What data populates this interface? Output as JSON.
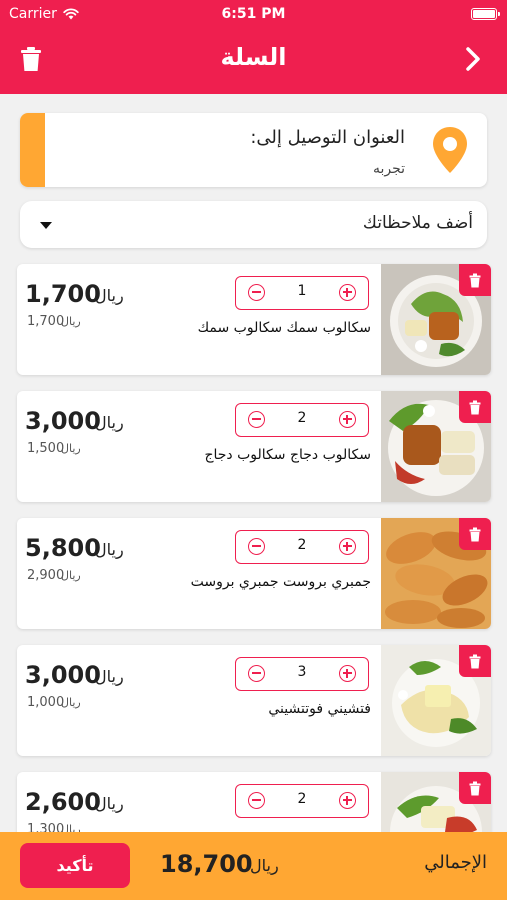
{
  "status_bar": {
    "carrier": "Carrier",
    "time": "6:51 PM"
  },
  "header": {
    "title": "السلة",
    "trash_icon": "trash-icon",
    "back_icon": "chevron-right-icon"
  },
  "address": {
    "label": "العنوان التوصيل إلى:",
    "value": "تجربه",
    "icon": "location-pin-icon"
  },
  "notes": {
    "placeholder": "أضف ملاحظاتك"
  },
  "currency": "ريال",
  "items": [
    {
      "name": "سكالوب سمك سكالوب سمك",
      "quantity": "1",
      "total": "1,700",
      "unit_price": "1,700"
    },
    {
      "name": "سكالوب دجاج سكالوب دجاج",
      "quantity": "2",
      "total": "3,000",
      "unit_price": "1,500"
    },
    {
      "name": "جمبري بروست جمبري بروست",
      "quantity": "2",
      "total": "5,800",
      "unit_price": "2,900"
    },
    {
      "name": "فتشيني فوتتشيني",
      "quantity": "3",
      "total": "3,000",
      "unit_price": "1,000"
    },
    {
      "name": "",
      "quantity": "2",
      "total": "2,600",
      "unit_price": "1,300"
    }
  ],
  "footer": {
    "total_label": "الإجمالي",
    "grand_total": "18,700",
    "confirm_label": "تأكيد"
  },
  "colors": {
    "primary": "#ef1f4f",
    "accent": "#ffa733",
    "background": "#f1f1f1"
  }
}
